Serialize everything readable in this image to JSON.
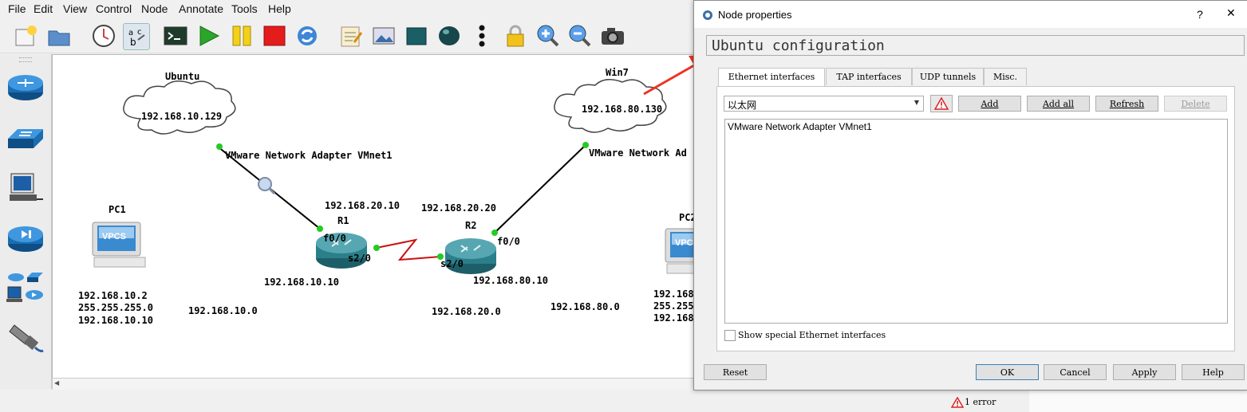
{
  "menu": [
    "File",
    "Edit",
    "View",
    "Control",
    "Node",
    "Annotate",
    "Tools",
    "Help"
  ],
  "toolbar_icons": [
    "new-project-icon",
    "open-project-icon",
    "snapshot-icon",
    "show-interface-labels-icon",
    "console-all-icon",
    "start-all-icon",
    "suspend-all-icon",
    "stop-all-icon",
    "reload-all-icon",
    "add-note-icon",
    "insert-picture-icon",
    "draw-rectangle-icon",
    "draw-ellipse-icon",
    "more-icon",
    "lock-icon",
    "zoom-in-icon",
    "zoom-out-icon",
    "screenshot-icon"
  ],
  "device_icons": [
    "router-icon",
    "switch-icon",
    "end-device-icon",
    "security-device-icon",
    "all-devices-icon",
    "add-link-icon"
  ],
  "topology": {
    "ubuntu_name": "Ubuntu",
    "ubuntu_ip": "192.168.10.129",
    "ubuntu_adapter": "VMware Network Adapter VMnet1",
    "win7_name": "Win7",
    "win7_ip": "192.168.80.130",
    "win7_adapter": "VMware Network Ad",
    "pc1_name": "PC1",
    "pc1_ip": "192.168.10.2",
    "pc1_mask": "255.255.255.0",
    "pc1_gw": "192.168.10.10",
    "pc2_name": "PC2",
    "pc2_ip": "192.168",
    "pc2_mask": "255.255",
    "pc2_gw": "192.168",
    "vpcs_label": "VPCS",
    "r1_name": "R1",
    "r2_name": "R2",
    "r1_f00": "f0/0",
    "r1_s20": "s2/0",
    "r2_s20": "s2/0",
    "r2_f00": "f0/0",
    "ip_r1_s": "192.168.20.10",
    "ip_r2_s": "192.168.20.20",
    "ip_r1_f": "192.168.10.10",
    "ip_r2_f": "192.168.80.10",
    "net_10": "192.168.10.0",
    "net_20": "192.168.20.0",
    "net_80": "192.168.80.0"
  },
  "status": {
    "errors": "1 error"
  },
  "dialog": {
    "title": "Node properties",
    "help_glyph": "?",
    "close_glyph": "✕",
    "group_title": "Ubuntu configuration",
    "tabs": [
      "Ethernet interfaces",
      "TAP interfaces",
      "UDP tunnels",
      "Misc."
    ],
    "selected_adapter": "以太网",
    "buttons": {
      "add": "Add",
      "add_all": "Add all",
      "refresh": "Refresh",
      "delete": "Delete"
    },
    "interfaces": [
      "VMware Network Adapter VMnet1"
    ],
    "show_special": "Show special Ethernet interfaces",
    "footer": {
      "reset": "Reset",
      "ok": "OK",
      "cancel": "Cancel",
      "apply": "Apply",
      "help": "Help"
    }
  },
  "colors": {
    "annotation_arrow": "#ee3322",
    "link_dot": "#22cc22",
    "serial_link": "#cc1111"
  }
}
